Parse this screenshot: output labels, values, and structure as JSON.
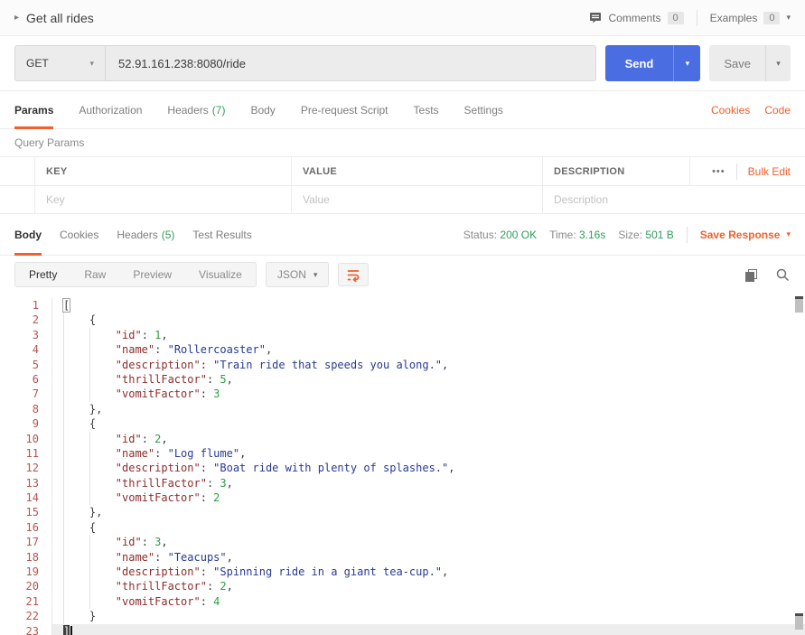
{
  "colors": {
    "accent": "#f0602e",
    "green": "#2e9e5b",
    "blue": "#4a6ee1",
    "key": "#8f2c2c",
    "str": "#283a92",
    "num": "#2f9e44",
    "ln": "#b5564e"
  },
  "header": {
    "title": "Get all rides",
    "comments_label": "Comments",
    "comments_count": "0",
    "examples_label": "Examples",
    "examples_count": "0"
  },
  "request": {
    "method": "GET",
    "url": "52.91.161.238:8080/ride",
    "send_label": "Send",
    "save_label": "Save"
  },
  "request_tabs": {
    "items": [
      {
        "label": "Params"
      },
      {
        "label": "Authorization"
      },
      {
        "label": "Headers",
        "count": "(7)"
      },
      {
        "label": "Body"
      },
      {
        "label": "Pre-request Script"
      },
      {
        "label": "Tests"
      },
      {
        "label": "Settings"
      }
    ],
    "cookies_label": "Cookies",
    "code_label": "Code"
  },
  "query_params": {
    "title": "Query Params",
    "columns": [
      "KEY",
      "VALUE",
      "DESCRIPTION"
    ],
    "placeholders": [
      "Key",
      "Value",
      "Description"
    ],
    "more_label": "•••",
    "bulk_edit_label": "Bulk Edit"
  },
  "response": {
    "tabs": [
      {
        "label": "Body"
      },
      {
        "label": "Cookies"
      },
      {
        "label": "Headers",
        "count": "(5)"
      },
      {
        "label": "Test Results"
      }
    ],
    "status_label": "Status:",
    "status_value": "200 OK",
    "time_label": "Time:",
    "time_value": "3.16s",
    "size_label": "Size:",
    "size_value": "501 B",
    "save_response_label": "Save Response",
    "view_tabs": [
      "Pretty",
      "Raw",
      "Preview",
      "Visualize"
    ],
    "language": "JSON"
  },
  "code": {
    "lines": [
      {
        "n": "1",
        "indent": 0,
        "tokens": [
          [
            "[",
            "punct",
            "open"
          ]
        ]
      },
      {
        "n": "2",
        "indent": 1,
        "tokens": [
          [
            "{",
            "punct"
          ]
        ]
      },
      {
        "n": "3",
        "indent": 2,
        "tokens": [
          [
            "\"id\"",
            "key"
          ],
          [
            ": ",
            "punct"
          ],
          [
            "1",
            "num"
          ],
          [
            ",",
            "punct"
          ]
        ]
      },
      {
        "n": "4",
        "indent": 2,
        "tokens": [
          [
            "\"name\"",
            "key"
          ],
          [
            ": ",
            "punct"
          ],
          [
            "\"Rollercoaster\"",
            "str"
          ],
          [
            ",",
            "punct"
          ]
        ]
      },
      {
        "n": "5",
        "indent": 2,
        "tokens": [
          [
            "\"description\"",
            "key"
          ],
          [
            ": ",
            "punct"
          ],
          [
            "\"Train ride that speeds you along.\"",
            "str"
          ],
          [
            ",",
            "punct"
          ]
        ]
      },
      {
        "n": "6",
        "indent": 2,
        "tokens": [
          [
            "\"thrillFactor\"",
            "key"
          ],
          [
            ": ",
            "punct"
          ],
          [
            "5",
            "num"
          ],
          [
            ",",
            "punct"
          ]
        ]
      },
      {
        "n": "7",
        "indent": 2,
        "tokens": [
          [
            "\"vomitFactor\"",
            "key"
          ],
          [
            ": ",
            "punct"
          ],
          [
            "3",
            "num"
          ]
        ]
      },
      {
        "n": "8",
        "indent": 1,
        "tokens": [
          [
            "},",
            "punct"
          ]
        ]
      },
      {
        "n": "9",
        "indent": 1,
        "tokens": [
          [
            "{",
            "punct"
          ]
        ]
      },
      {
        "n": "10",
        "indent": 2,
        "tokens": [
          [
            "\"id\"",
            "key"
          ],
          [
            ": ",
            "punct"
          ],
          [
            "2",
            "num"
          ],
          [
            ",",
            "punct"
          ]
        ]
      },
      {
        "n": "11",
        "indent": 2,
        "tokens": [
          [
            "\"name\"",
            "key"
          ],
          [
            ": ",
            "punct"
          ],
          [
            "\"Log flume\"",
            "str"
          ],
          [
            ",",
            "punct"
          ]
        ]
      },
      {
        "n": "12",
        "indent": 2,
        "tokens": [
          [
            "\"description\"",
            "key"
          ],
          [
            ": ",
            "punct"
          ],
          [
            "\"Boat ride with plenty of splashes.\"",
            "str"
          ],
          [
            ",",
            "punct"
          ]
        ]
      },
      {
        "n": "13",
        "indent": 2,
        "tokens": [
          [
            "\"thrillFactor\"",
            "key"
          ],
          [
            ": ",
            "punct"
          ],
          [
            "3",
            "num"
          ],
          [
            ",",
            "punct"
          ]
        ]
      },
      {
        "n": "14",
        "indent": 2,
        "tokens": [
          [
            "\"vomitFactor\"",
            "key"
          ],
          [
            ": ",
            "punct"
          ],
          [
            "2",
            "num"
          ]
        ]
      },
      {
        "n": "15",
        "indent": 1,
        "tokens": [
          [
            "},",
            "punct"
          ]
        ]
      },
      {
        "n": "16",
        "indent": 1,
        "tokens": [
          [
            "{",
            "punct"
          ]
        ]
      },
      {
        "n": "17",
        "indent": 2,
        "tokens": [
          [
            "\"id\"",
            "key"
          ],
          [
            ": ",
            "punct"
          ],
          [
            "3",
            "num"
          ],
          [
            ",",
            "punct"
          ]
        ]
      },
      {
        "n": "18",
        "indent": 2,
        "tokens": [
          [
            "\"name\"",
            "key"
          ],
          [
            ": ",
            "punct"
          ],
          [
            "\"Teacups\"",
            "str"
          ],
          [
            ",",
            "punct"
          ]
        ]
      },
      {
        "n": "19",
        "indent": 2,
        "tokens": [
          [
            "\"description\"",
            "key"
          ],
          [
            ": ",
            "punct"
          ],
          [
            "\"Spinning ride in a giant tea-cup.\"",
            "str"
          ],
          [
            ",",
            "punct"
          ]
        ]
      },
      {
        "n": "20",
        "indent": 2,
        "tokens": [
          [
            "\"thrillFactor\"",
            "key"
          ],
          [
            ": ",
            "punct"
          ],
          [
            "2",
            "num"
          ],
          [
            ",",
            "punct"
          ]
        ]
      },
      {
        "n": "21",
        "indent": 2,
        "tokens": [
          [
            "\"vomitFactor\"",
            "key"
          ],
          [
            ": ",
            "punct"
          ],
          [
            "4",
            "num"
          ]
        ]
      },
      {
        "n": "22",
        "indent": 1,
        "tokens": [
          [
            "}",
            "punct"
          ]
        ]
      },
      {
        "n": "23",
        "indent": 0,
        "active": true,
        "cursor": true,
        "tokens": [
          [
            "]",
            "punct",
            "close"
          ]
        ]
      }
    ]
  }
}
